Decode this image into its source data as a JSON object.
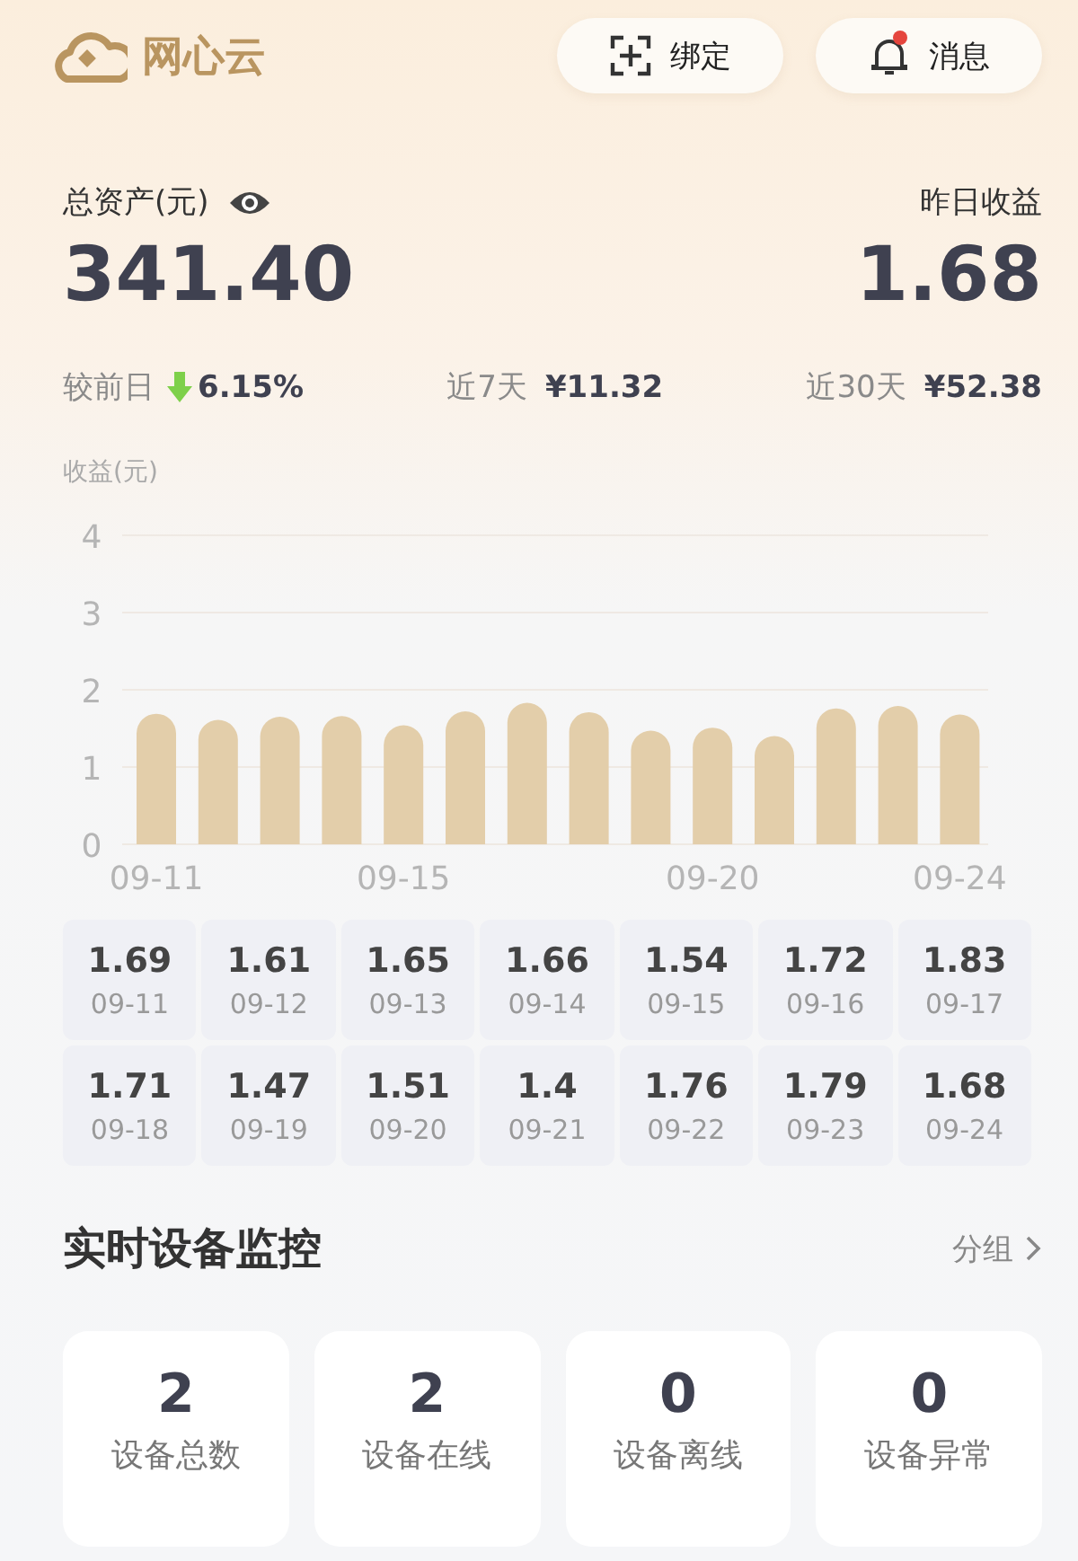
{
  "app": {
    "title": "网心云"
  },
  "header_buttons": [
    {
      "kind": "scan",
      "label": "绑定"
    },
    {
      "kind": "bell",
      "label": "消息",
      "unread": true
    }
  ],
  "summary": {
    "assets_label": "总资产(元)",
    "assets_value": "341.40",
    "yesterday_label": "昨日收益",
    "yesterday_value": "1.68"
  },
  "stats": [
    {
      "kind": "change",
      "label": "较前日",
      "value": "6.15%"
    },
    {
      "kind": "amount",
      "label": "近7天",
      "value": "¥11.32"
    },
    {
      "kind": "amount",
      "label": "近30天",
      "value": "¥52.38"
    }
  ],
  "earnings_chart": {
    "chart_data": {
      "type": "bar",
      "ylabel": "收益(元)",
      "categories": [
        "09-11",
        null,
        null,
        null,
        "09-15",
        null,
        null,
        null,
        null,
        "09-20",
        null,
        null,
        null,
        "09-24"
      ],
      "grid": true,
      "series": [
        {
          "color": "#e3ceaa",
          "values": [
            1.69,
            1.61,
            1.65,
            1.66,
            1.54,
            1.72,
            1.83,
            1.71,
            1.47,
            1.51,
            1.4,
            1.76,
            1.79,
            1.68
          ]
        }
      ],
      "ylim": [
        0,
        4
      ],
      "yticks": [
        0,
        1,
        2,
        3,
        4
      ]
    }
  },
  "daily_earnings": [
    {
      "value": "1.69",
      "date": "09-11"
    },
    {
      "value": "1.61",
      "date": "09-12"
    },
    {
      "value": "1.65",
      "date": "09-13"
    },
    {
      "value": "1.66",
      "date": "09-14"
    },
    {
      "value": "1.54",
      "date": "09-15"
    },
    {
      "value": "1.72",
      "date": "09-16"
    },
    {
      "value": "1.83",
      "date": "09-17"
    },
    {
      "value": "1.71",
      "date": "09-18"
    },
    {
      "value": "1.47",
      "date": "09-19"
    },
    {
      "value": "1.51",
      "date": "09-20"
    },
    {
      "value": "1.4",
      "date": "09-21"
    },
    {
      "value": "1.76",
      "date": "09-22"
    },
    {
      "value": "1.79",
      "date": "09-23"
    },
    {
      "value": "1.68",
      "date": "09-24"
    }
  ],
  "monitor": {
    "title": "实时设备监控",
    "link": "分组",
    "cards": [
      {
        "count": "2",
        "label": "设备总数"
      },
      {
        "count": "2",
        "label": "设备在线"
      },
      {
        "count": "0",
        "label": "设备离线"
      },
      {
        "count": "0",
        "label": "设备异常"
      }
    ]
  }
}
